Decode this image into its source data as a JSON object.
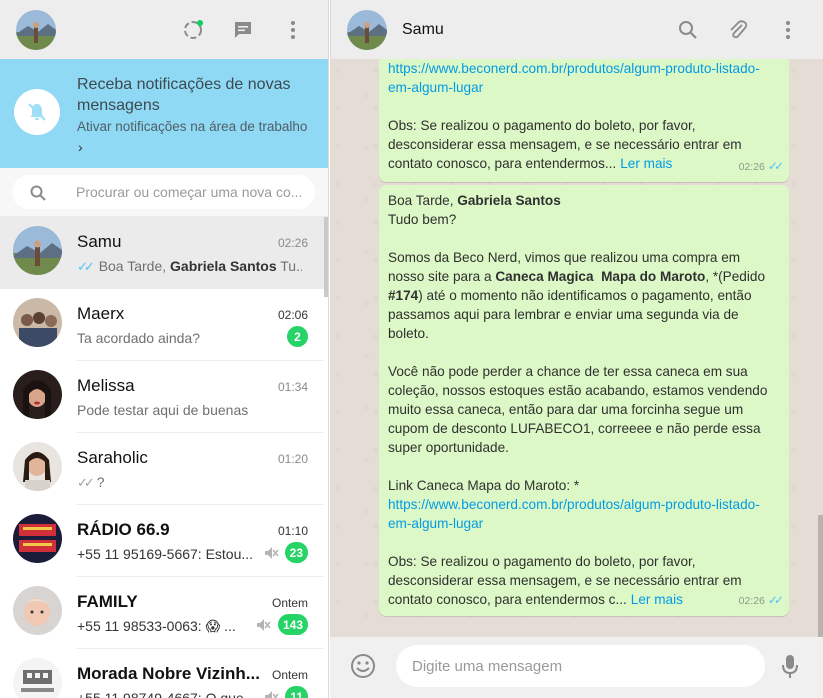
{
  "left_header": {
    "profile_avatar": "profile-avatar-landscape",
    "icons": [
      "status-icon",
      "new-chat-icon",
      "menu-icon"
    ]
  },
  "notification_banner": {
    "title": "Receba notificações de novas mensagens",
    "subtitle": "Ativar notificações na área de trabalho",
    "chevron": "›"
  },
  "search": {
    "placeholder": "Procurar ou começar uma nova co..."
  },
  "chats": [
    {
      "name": "Samu",
      "time": "02:26",
      "preview_prefix": "Boa Tarde, ",
      "preview_bold": "Gabriela Santos",
      "preview_suffix": " Tu...",
      "read": true,
      "active": true
    },
    {
      "name": "Maerx",
      "time": "02:06",
      "preview": "Ta acordado ainda?",
      "unread": "2"
    },
    {
      "name": "Melissa",
      "time": "01:34",
      "preview": "Pode testar aqui de buenas"
    },
    {
      "name": "Saraholic",
      "time": "01:20",
      "preview": "?",
      "sent": true
    },
    {
      "name": "RÁDIO 66.9",
      "time": "01:10",
      "preview": "+55 11 95169-5667: Estou...",
      "unread": "23",
      "muted": true
    },
    {
      "name": "FAMILY",
      "time": "Ontem",
      "preview": "+55 11 98533-0063: 😱 ...",
      "unread": "143",
      "muted": true
    },
    {
      "name": "Morada Nobre Vizinh...",
      "time": "Ontem",
      "preview": "+55 11 98749-4667: O que...",
      "unread": "11",
      "muted": true
    }
  ],
  "conversation": {
    "contact_name": "Samu",
    "icons": [
      "search-icon",
      "attach-icon",
      "menu-icon"
    ],
    "messages": [
      {
        "link": "https://www.beconerd.com.br/produtos/algum-produto-listado-em-algum-lugar",
        "body": "Obs: Se realizou o pagamento do boleto, por favor, desconsiderar essa mensagem, e se necessário entrar em contato conosco, para entendermos...",
        "more": "Ler mais",
        "time": "02:26"
      },
      {
        "greeting": "Boa Tarde, ",
        "greeting_name": "Gabriela Santos",
        "line2": "Tudo bem?",
        "p1_a": "Somos da Beco Nerd, vimos que realizou uma compra em nosso site para a ",
        "p1_product": "Caneca Magica  Mapa do Maroto",
        "p1_b": ", *(Pedido ",
        "p1_order": "#174",
        "p1_c": ") até o momento não identificamos o pagamento, então passamos aqui para lembrar e enviar uma segunda via de boleto.",
        "p2": "Você não pode perder a chance de ter essa caneca em sua coleção, nossos estoques estão acabando, estamos vendendo muito essa caneca, então para dar uma forcinha segue um cupom de desconto LUFABECO1, correeee e não perde essa super oportunidade.",
        "link_label": "Link Caneca Mapa do Maroto: *",
        "link": "https://www.beconerd.com.br/produtos/algum-produto-listado-em-algum-lugar",
        "body": "Obs: Se realizou o pagamento do boleto, por favor, desconsiderar essa mensagem, e se necessário entrar em contato conosco, para entendermos c...",
        "more": "Ler mais",
        "time": "02:26"
      }
    ]
  },
  "composer": {
    "placeholder": "Digite uma mensagem",
    "icons": [
      "emoji-icon",
      "mic-icon"
    ]
  },
  "colors": {
    "notification_bg": "#8fd9f5",
    "bubble_out": "#dcf8c6",
    "badge": "#25d366",
    "link": "#039be5",
    "read_tick": "#4fc3f7"
  }
}
